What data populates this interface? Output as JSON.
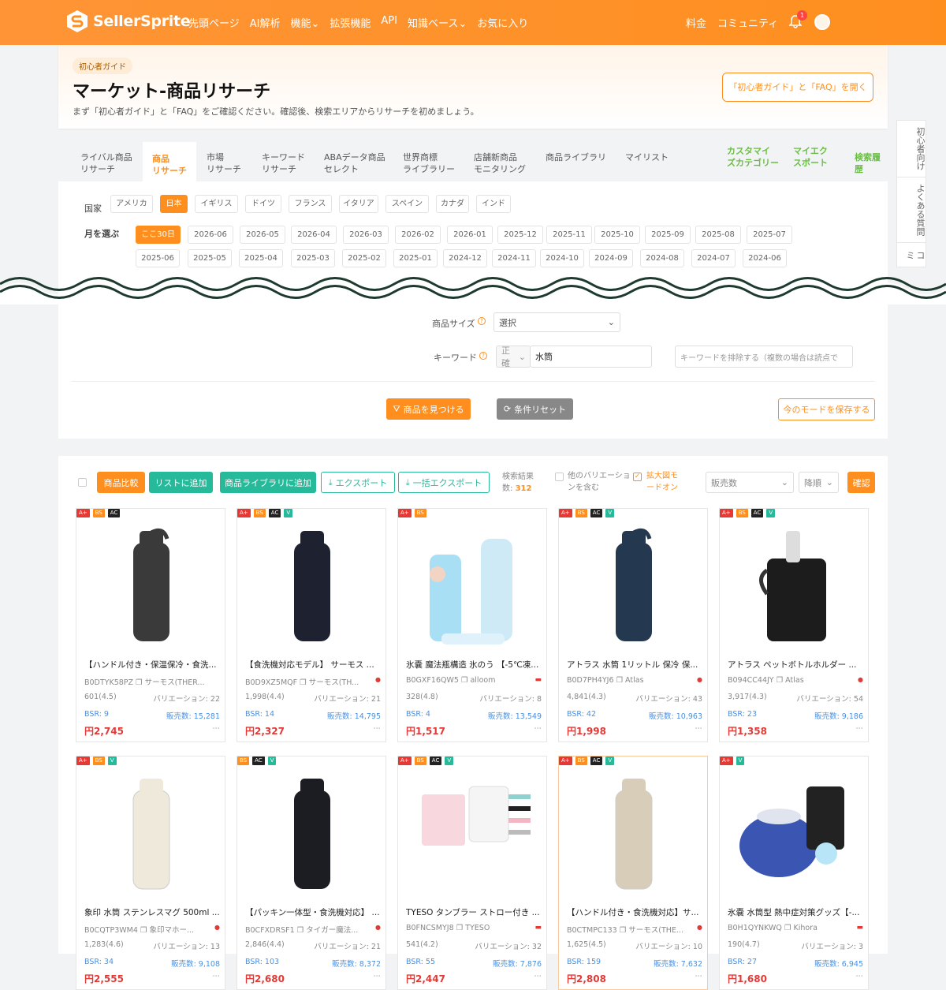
{
  "brand": "SellerSprite",
  "nav": [
    "先頭ページ",
    "AI解析",
    "機能",
    "拡張機能",
    "API",
    "知識ベース",
    "お気に入り"
  ],
  "nav_right": [
    "料金",
    "コミュニティ"
  ],
  "notif_count": "1",
  "hero": {
    "tag": "初心者ガイド",
    "title": "マーケット-商品リサーチ",
    "subtitle": "まず「初心者ガイド」と「FAQ」をご確認ください。確認後、検索エリアからリサーチを初めましょう。",
    "button": "「初心者ガイド」と「FAQ」を開く"
  },
  "tabs": [
    [
      "ライバル商品",
      "リサーチ"
    ],
    [
      "商品",
      "リサーチ"
    ],
    [
      "市場",
      "リサーチ"
    ],
    [
      "キーワード",
      "リサーチ"
    ],
    [
      "ABAデータ商品",
      "セレクト"
    ],
    [
      "世界商標",
      "ライブラリー"
    ],
    [
      "店舗新商品",
      "モニタリング"
    ],
    [
      "商品ライブラリ",
      ""
    ],
    [
      "マイリスト",
      ""
    ]
  ],
  "tabs_green": [
    [
      "カスタマイ",
      "ズカテゴリー"
    ],
    [
      "マイエク",
      "スポート"
    ],
    [
      "検索履歴",
      ""
    ]
  ],
  "side": [
    "初心者向け",
    "よくある質問",
    "コミ"
  ],
  "country_label": "国家",
  "countries": [
    "アメリカ",
    "日本",
    "イギリス",
    "ドイツ",
    "フランス",
    "イタリア",
    "スペイン",
    "カナダ",
    "インド"
  ],
  "month_label": "月を選ぶ",
  "months1": [
    "ここ30日",
    "2026-06",
    "2026-05",
    "2026-04",
    "2026-03",
    "2026-02",
    "2026-01",
    "2025-12",
    "2025-11",
    "2025-10",
    "2025-09",
    "2025-08",
    "2025-07"
  ],
  "months2": [
    "2025-06",
    "2025-05",
    "2025-04",
    "2025-03",
    "2025-02",
    "2025-01",
    "2024-12",
    "2024-11",
    "2024-10",
    "2024-09",
    "2024-08",
    "2024-07",
    "2024-06"
  ],
  "filters": {
    "size_label": "商品サイズ",
    "size_value": "選択",
    "kw_label": "キーワード",
    "kw_mode": "正確",
    "kw_value": "水筒",
    "exclude_placeholder": "キーワードを排除する（複数の場合は読点で"
  },
  "actions": {
    "find": "商品を見つける",
    "reset": "条件リセット",
    "save": "今のモードを保存する"
  },
  "toolbar": {
    "compare": "商品比較",
    "add_list": "リストに追加",
    "add_lib": "商品ライブラリに追加",
    "export": "エクスポート",
    "bulk_export": "一括エクスポート",
    "result_label": "検索結果",
    "result_prefix": "数:",
    "result_count": "312",
    "variation1": "他のバリエーショ",
    "variation2": "ンを含む",
    "zoom1": "拡大図モ",
    "zoom2": "ードオン",
    "sort": "販売数",
    "order": "降順",
    "confirm": "確認"
  },
  "products": [
    {
      "badges": [
        "A+",
        "BS",
        "AC"
      ],
      "title": "【ハンドル付き・保温保冷・食洗...",
      "asin": "B0DTYK58PZ",
      "brand": "サーモス(THER...",
      "flag": "",
      "rating": "601(4.5)",
      "variations": "バリエーション: 22",
      "bsr": "BSR: 9",
      "sales": "販売数: 15,281",
      "price": "円2,745"
    },
    {
      "badges": [
        "A+",
        "BS",
        "AC",
        "V"
      ],
      "title": "【食洗機対応モデル】 サーモス ...",
      "asin": "B0D9XZ5MQF",
      "brand": "サーモス(TH...",
      "flag": "jp",
      "rating": "1,998(4.4)",
      "variations": "バリエーション: 21",
      "bsr": "BSR: 14",
      "sales": "販売数: 14,795",
      "price": "円2,327"
    },
    {
      "badges": [
        "A+",
        "BS"
      ],
      "title": "氷嚢 魔法瓶構造 氷のう 【-5℃凍...",
      "asin": "B0GXF16QW5",
      "brand": "alloom",
      "flag": "cn",
      "rating": "328(4.8)",
      "variations": "バリエーション: 8",
      "bsr": "BSR: 4",
      "sales": "販売数: 13,549",
      "price": "円1,517"
    },
    {
      "badges": [
        "A+",
        "BS",
        "AC",
        "V"
      ],
      "title": "アトラス 水筒 1リットル 保冷 保...",
      "asin": "B0D7PH4YJ6",
      "brand": "Atlas",
      "flag": "jp",
      "rating": "4,841(4.3)",
      "variations": "バリエーション: 43",
      "bsr": "BSR: 42",
      "sales": "販売数: 10,963",
      "price": "円1,998"
    },
    {
      "badges": [
        "A+",
        "BS",
        "AC",
        "V"
      ],
      "title": "アトラス ペットボトルホルダー ...",
      "asin": "B094CC44JY",
      "brand": "Atlas",
      "flag": "jp",
      "rating": "3,917(4.3)",
      "variations": "バリエーション: 54",
      "bsr": "BSR: 23",
      "sales": "販売数: 9,186",
      "price": "円1,358"
    },
    {
      "badges": [
        "A+",
        "BS",
        "V"
      ],
      "title": "象印 水筒 ステンレスマグ 500ml ...",
      "asin": "B0CQTP3WM4",
      "brand": "象印マホー...",
      "flag": "jp",
      "rating": "1,283(4.6)",
      "variations": "バリエーション: 13",
      "bsr": "BSR: 34",
      "sales": "販売数: 9,108",
      "price": "円2,555"
    },
    {
      "badges": [
        "BS",
        "AC",
        "V"
      ],
      "title": "【パッキン一体型・食洗機対応】 ...",
      "asin": "B0CFXDRSF1",
      "brand": "タイガー魔法...",
      "flag": "jp",
      "rating": "2,846(4.4)",
      "variations": "バリエーション: 21",
      "bsr": "BSR: 103",
      "sales": "販売数: 8,372",
      "price": "円2,680"
    },
    {
      "badges": [
        "A+",
        "BS",
        "AC",
        "V"
      ],
      "title": "TYESO タンブラー ストロー付き ...",
      "asin": "B0FNCSMYJ8",
      "brand": "TYESO",
      "flag": "cn",
      "rating": "541(4.2)",
      "variations": "バリエーション: 32",
      "bsr": "BSR: 55",
      "sales": "販売数: 7,876",
      "price": "円2,447"
    },
    {
      "badges": [
        "A+",
        "BS",
        "AC",
        "V"
      ],
      "title": "【ハンドル付き・食洗機対応】サ...",
      "asin": "B0CTMPC133",
      "brand": "サーモス(THE...",
      "flag": "jp",
      "rating": "1,625(4.5)",
      "variations": "バリエーション: 10",
      "bsr": "BSR: 159",
      "sales": "販売数: 7,632",
      "price": "円2,808"
    },
    {
      "badges": [
        "A+",
        "V"
      ],
      "title": "氷嚢 水筒型 熱中症対策グッズ【-...",
      "asin": "B0H1QYNKWQ",
      "brand": "Kihora",
      "flag": "cn",
      "rating": "190(4.7)",
      "variations": "バリエーション: 3",
      "bsr": "BSR: 27",
      "sales": "販売数: 6,945",
      "price": "円1,680"
    }
  ]
}
